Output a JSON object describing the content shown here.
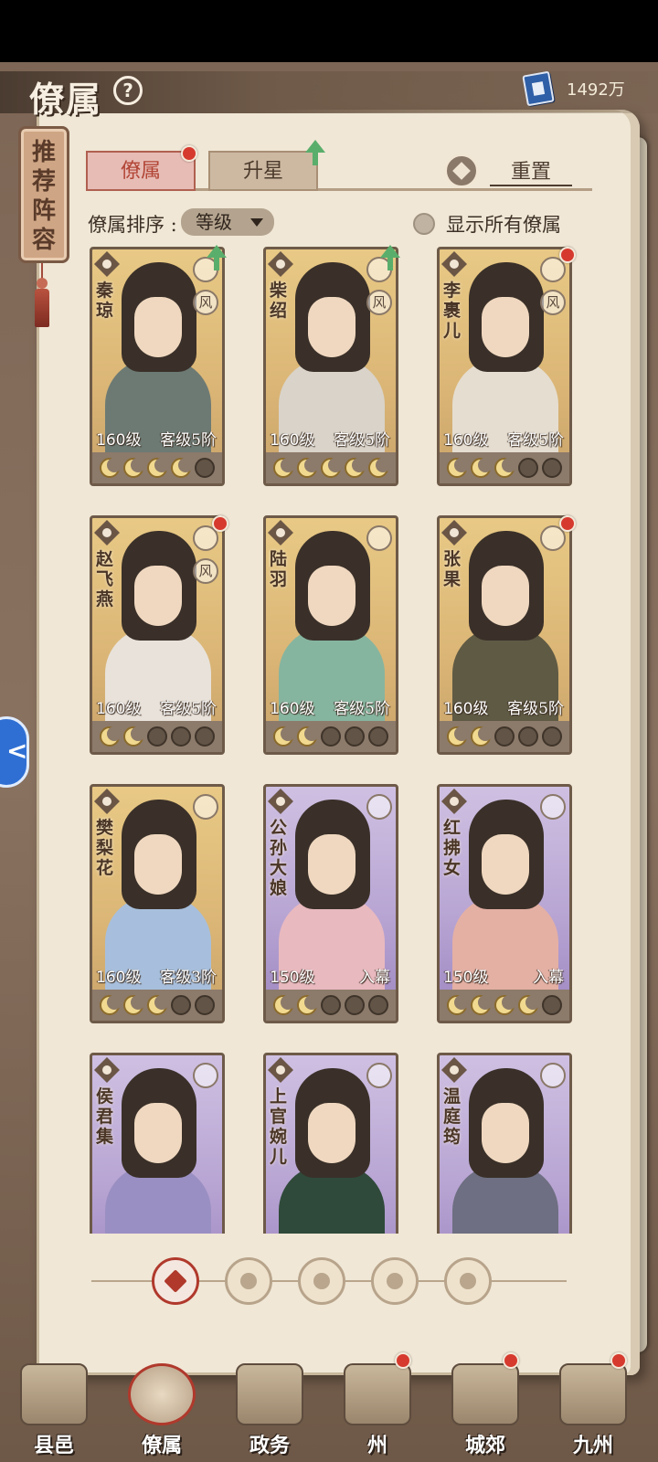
{
  "header": {
    "title": "僚属",
    "help_symbol": "?",
    "currency_value": "1492万",
    "currency_icon": "book-icon"
  },
  "banner": {
    "text": "推荐阵容"
  },
  "tabs": [
    {
      "label": "僚属",
      "active": true,
      "red_dot": true
    },
    {
      "label": "升星",
      "active": false,
      "up_arrow": true
    }
  ],
  "reset_label": "重置",
  "sort": {
    "label": "僚属排序 :",
    "value": "等级"
  },
  "show_all_label": "显示所有僚属",
  "feng_char": "风",
  "cards": [
    {
      "name": "秦琼",
      "level": "160级",
      "rank": "客级5阶",
      "frame": "gold",
      "moons_on": 4,
      "feng": true,
      "marker": "arrow",
      "robe": "#6d7a74"
    },
    {
      "name": "柴绍",
      "level": "160级",
      "rank": "客级5阶",
      "frame": "gold",
      "moons_on": 5,
      "feng": true,
      "marker": "arrow",
      "robe": "#d9d3c9"
    },
    {
      "name": "李裹儿",
      "level": "160级",
      "rank": "客级5阶",
      "frame": "gold",
      "moons_on": 3,
      "feng": true,
      "marker": "dot",
      "robe": "#e5ddd0"
    },
    {
      "name": "赵飞燕",
      "level": "160级",
      "rank": "客级5阶",
      "frame": "gold",
      "moons_on": 2,
      "feng": true,
      "marker": "dot",
      "robe": "#e8e2da"
    },
    {
      "name": "陆羽",
      "level": "160级",
      "rank": "客级5阶",
      "frame": "gold",
      "moons_on": 2,
      "feng": false,
      "marker": "none",
      "robe": "#86b59f"
    },
    {
      "name": "张果",
      "level": "160级",
      "rank": "客级5阶",
      "frame": "gold",
      "moons_on": 2,
      "feng": false,
      "marker": "dot",
      "robe": "#5f5a44"
    },
    {
      "name": "樊梨花",
      "level": "160级",
      "rank": "客级3阶",
      "frame": "gold",
      "moons_on": 3,
      "feng": false,
      "marker": "none",
      "robe": "#a7bfdc"
    },
    {
      "name": "公孙大娘",
      "level": "150级",
      "rank": "入幕",
      "frame": "purple",
      "moons_on": 2,
      "feng": false,
      "marker": "none",
      "robe": "#e8b9bf"
    },
    {
      "name": "红拂女",
      "level": "150级",
      "rank": "入幕",
      "frame": "purple",
      "moons_on": 4,
      "feng": false,
      "marker": "none",
      "robe": "#e4b0a4"
    },
    {
      "name": "侯君集",
      "level": "",
      "rank": "",
      "frame": "purple",
      "moons_on": 0,
      "feng": false,
      "marker": "none",
      "robe": "#9a8fc2"
    },
    {
      "name": "上官婉儿",
      "level": "",
      "rank": "",
      "frame": "purple",
      "moons_on": 0,
      "feng": false,
      "marker": "none",
      "robe": "#2f4a3a"
    },
    {
      "name": "温庭筠",
      "level": "",
      "rank": "",
      "frame": "purple",
      "moons_on": 0,
      "feng": false,
      "marker": "none",
      "robe": "#6e6f82"
    }
  ],
  "filters": [
    {
      "icon": "all-filter-icon",
      "active": true
    },
    {
      "icon": "faction-bell-icon",
      "active": false
    },
    {
      "icon": "faction-beast-icon",
      "active": false
    },
    {
      "icon": "faction-fan-icon",
      "active": false
    },
    {
      "icon": "faction-lion-icon",
      "active": false
    }
  ],
  "nav": [
    {
      "label": "县邑",
      "active": false,
      "red_dot": false
    },
    {
      "label": "僚属",
      "active": true,
      "red_dot": false
    },
    {
      "label": "政务",
      "active": false,
      "red_dot": false
    },
    {
      "label": "州",
      "active": false,
      "red_dot": true
    },
    {
      "label": "城郊",
      "active": false,
      "red_dot": true
    },
    {
      "label": "九州",
      "active": false,
      "red_dot": true
    }
  ],
  "colors": {
    "accent_red": "#d63a2e",
    "upgrade_green": "#5aae6c",
    "gold_frame": "#dcb777",
    "purple_frame": "#b8a5d3"
  }
}
